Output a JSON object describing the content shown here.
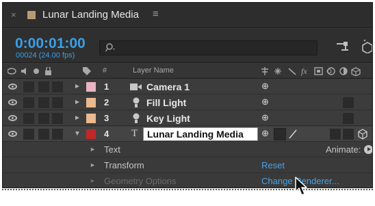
{
  "tab": {
    "close_glyph": "×",
    "title": "Lunar Landing Media",
    "menu_glyph": "≡",
    "swatch_color": "#b89a76"
  },
  "time": {
    "timecode": "0:00:01:00",
    "frames": "00024 (24.00 fps)",
    "accent_color": "#39a0e8"
  },
  "search": {
    "icon": "search-icon",
    "value": ""
  },
  "header": {
    "hash": "#",
    "layer_name": "Layer Name",
    "switch_icons": [
      "shy-icon",
      "collapse-icon",
      "quality-icon",
      "fx-icon",
      "frame-blend-icon",
      "motion-blur-icon",
      "adjustment-icon",
      "3d-icon"
    ]
  },
  "layers": [
    {
      "num": "1",
      "name": "Camera 1",
      "type": "camera-icon",
      "color": "#e8b4c4",
      "twirl": "►"
    },
    {
      "num": "2",
      "name": "Fill Light",
      "type": "light-icon",
      "color": "#e9b98f",
      "twirl": "►"
    },
    {
      "num": "3",
      "name": "Key Light",
      "type": "light-icon",
      "color": "#e9b98f",
      "twirl": "►"
    },
    {
      "num": "4",
      "name": "Lunar Landing Media",
      "type_glyph": "T",
      "color": "#c0282a",
      "twirl": "▼"
    }
  ],
  "properties": [
    {
      "label": "Text",
      "action": "Animate:"
    },
    {
      "label": "Transform",
      "action": "Reset"
    },
    {
      "label": "Geometry Options",
      "action": "Change Renderer..."
    }
  ],
  "colors": {
    "link": "#47a3e6",
    "selected_row": "#444444",
    "panel": "#3a3a3a"
  }
}
